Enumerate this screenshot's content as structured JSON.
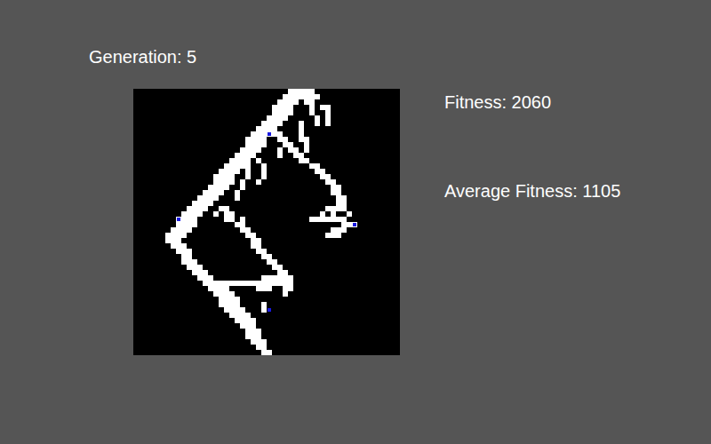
{
  "generation": {
    "label": "Generation: 5"
  },
  "stats": [
    {
      "label": "Fitness: 2060"
    },
    {
      "label": "Average Fitness: 1105"
    }
  ],
  "grid": {
    "size": 50,
    "rows": [
      [
        [
          29,
          5
        ]
      ],
      [
        [
          28,
          5
        ],
        [
          33,
          2
        ]
      ],
      [
        [
          27,
          4
        ],
        [
          32,
          2
        ]
      ],
      [
        [
          26,
          4
        ],
        [
          33,
          1
        ],
        [
          35,
          2
        ]
      ],
      [
        [
          26,
          4
        ],
        [
          33,
          1
        ],
        [
          36,
          1
        ]
      ],
      [
        [
          25,
          4
        ],
        [
          34,
          1
        ],
        [
          36,
          1
        ]
      ],
      [
        [
          24,
          4
        ],
        [
          31,
          1
        ],
        [
          34,
          1
        ],
        [
          36,
          1
        ]
      ],
      [
        [
          23,
          4
        ],
        [
          31,
          1
        ]
      ],
      [
        [
          22,
          6
        ],
        [
          31,
          1
        ]
      ],
      [
        [
          21,
          4
        ],
        [
          27,
          2
        ],
        [
          31,
          2
        ]
      ],
      [
        [
          21,
          4
        ],
        [
          28,
          2
        ],
        [
          32,
          1
        ]
      ],
      [
        [
          20,
          4
        ],
        [
          27,
          1
        ],
        [
          29,
          2
        ],
        [
          32,
          1
        ]
      ],
      [
        [
          19,
          4
        ],
        [
          27,
          1
        ],
        [
          30,
          2
        ]
      ],
      [
        [
          18,
          4
        ],
        [
          23,
          1
        ],
        [
          31,
          2
        ]
      ],
      [
        [
          17,
          5
        ],
        [
          24,
          1
        ],
        [
          33,
          2
        ]
      ],
      [
        [
          16,
          4
        ],
        [
          21,
          1
        ],
        [
          24,
          1
        ],
        [
          34,
          2
        ]
      ],
      [
        [
          15,
          4
        ],
        [
          21,
          1
        ],
        [
          24,
          1
        ],
        [
          35,
          2
        ]
      ],
      [
        [
          15,
          4
        ],
        [
          20,
          1
        ],
        [
          23,
          1
        ],
        [
          36,
          2
        ]
      ],
      [
        [
          14,
          4
        ],
        [
          20,
          1
        ],
        [
          37,
          2
        ]
      ],
      [
        [
          13,
          4
        ],
        [
          19,
          1
        ],
        [
          37,
          2
        ]
      ],
      [
        [
          12,
          4
        ],
        [
          19,
          1
        ],
        [
          38,
          2
        ]
      ],
      [
        [
          11,
          4
        ],
        [
          38,
          2
        ]
      ],
      [
        [
          10,
          4
        ],
        [
          16,
          2
        ],
        [
          36,
          4
        ]
      ],
      [
        [
          9,
          4
        ],
        [
          15,
          1
        ],
        [
          17,
          2
        ],
        [
          35,
          1
        ],
        [
          37,
          1
        ],
        [
          40,
          1
        ]
      ],
      [
        [
          8,
          4
        ],
        [
          17,
          2
        ],
        [
          20,
          1
        ],
        [
          33,
          6
        ],
        [
          39,
          1
        ]
      ],
      [
        [
          8,
          4
        ],
        [
          19,
          2
        ],
        [
          39,
          3
        ]
      ],
      [
        [
          7,
          4
        ],
        [
          20,
          2
        ],
        [
          37,
          3
        ]
      ],
      [
        [
          6,
          4
        ],
        [
          21,
          2
        ],
        [
          36,
          3
        ]
      ],
      [
        [
          6,
          3
        ],
        [
          22,
          2
        ]
      ],
      [
        [
          7,
          3
        ],
        [
          22,
          2
        ]
      ],
      [
        [
          8,
          3
        ],
        [
          23,
          2
        ]
      ],
      [
        [
          9,
          2
        ],
        [
          24,
          2
        ]
      ],
      [
        [
          9,
          3
        ],
        [
          25,
          2
        ]
      ],
      [
        [
          10,
          3
        ],
        [
          26,
          2
        ]
      ],
      [
        [
          11,
          3
        ],
        [
          27,
          2
        ]
      ],
      [
        [
          12,
          3
        ],
        [
          24,
          6
        ]
      ],
      [
        [
          13,
          17
        ]
      ],
      [
        [
          14,
          4
        ],
        [
          23,
          3
        ],
        [
          28,
          2
        ]
      ],
      [
        [
          15,
          4
        ],
        [
          28,
          1
        ]
      ],
      [
        [
          16,
          4
        ]
      ],
      [
        [
          16,
          4
        ],
        [
          24,
          1
        ]
      ],
      [
        [
          17,
          4
        ],
        [
          24,
          1
        ]
      ],
      [
        [
          18,
          4
        ]
      ],
      [
        [
          19,
          4
        ]
      ],
      [
        [
          20,
          3
        ]
      ],
      [
        [
          21,
          3
        ]
      ],
      [
        [
          21,
          3
        ]
      ],
      [
        [
          22,
          3
        ]
      ],
      [
        [
          23,
          2
        ]
      ],
      [
        [
          24,
          2
        ]
      ]
    ],
    "markers": [
      {
        "row": 8,
        "col": 25,
        "color": "#1a1ae0"
      },
      {
        "row": 24,
        "col": 8,
        "color": "#1a1ae0"
      },
      {
        "row": 25,
        "col": 41,
        "color": "#1a1ae0"
      },
      {
        "row": 41,
        "col": 25,
        "color": "#1a1ae0"
      }
    ]
  }
}
